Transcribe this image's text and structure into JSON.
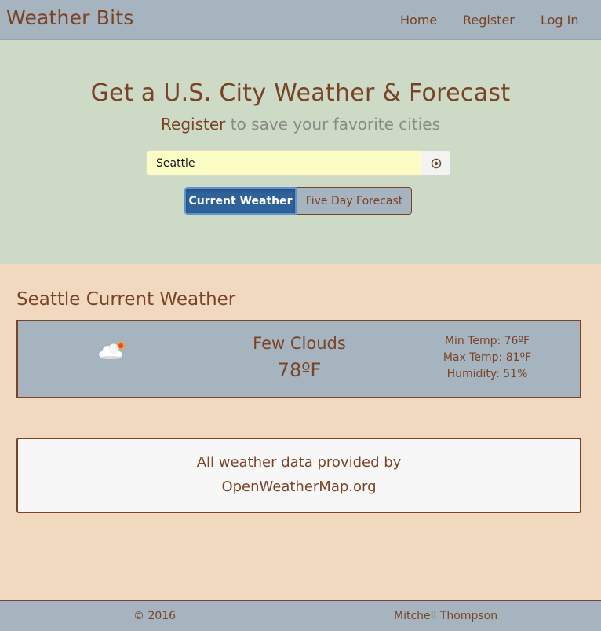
{
  "navbar": {
    "brand": "Weather Bits",
    "links": {
      "home": "Home",
      "register": "Register",
      "login": "Log In"
    }
  },
  "hero": {
    "title": "Get a U.S. City Weather & Forecast",
    "subtitle_link": "Register",
    "subtitle_rest": " to save your favorite cities",
    "search": {
      "value": "Seattle"
    },
    "locate_icon": "target-icon",
    "buttons": {
      "current": "Current Weather",
      "forecast": "Five Day Forecast"
    }
  },
  "weather": {
    "title": "Seattle Current Weather",
    "icon": "partly-cloudy-icon",
    "condition": "Few Clouds",
    "temperature": "78ºF",
    "min_temp": "Min Temp: 76ºF",
    "max_temp": "Max Temp: 81ºF",
    "humidity": "Humidity: 51%"
  },
  "attribution": {
    "line1": "All weather data provided by",
    "line2": "OpenWeatherMap.org"
  },
  "footer": {
    "copyright": "© 2016",
    "author": "Mitchell Thompson"
  },
  "colors": {
    "brown": "#7a4326",
    "nav_bg": "#a6b4bf",
    "hero_bg": "#ccdac6",
    "page_bg": "#f0d9bf",
    "active_button": "#2e6299",
    "search_bg": "#fbfdc4"
  }
}
